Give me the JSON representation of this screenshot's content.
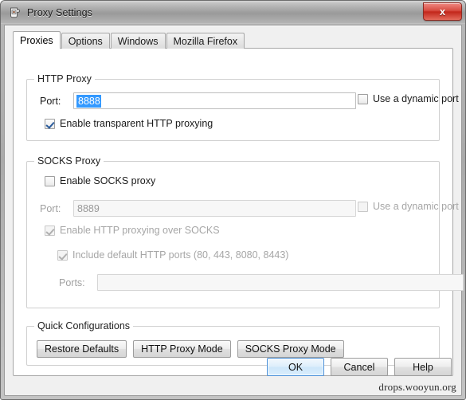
{
  "window": {
    "title": "Proxy Settings",
    "icon": "burp-jar-icon",
    "close_label": "x"
  },
  "tabs": [
    {
      "label": "Proxies",
      "active": true
    },
    {
      "label": "Options",
      "active": false
    },
    {
      "label": "Windows",
      "active": false
    },
    {
      "label": "Mozilla Firefox",
      "active": false
    }
  ],
  "http_proxy": {
    "group_title": "HTTP Proxy",
    "port_label": "Port:",
    "port_value": "8888",
    "port_selected": true,
    "dynamic_port_label": "Use a dynamic port",
    "dynamic_port_checked": false,
    "transparent_label": "Enable transparent HTTP proxying",
    "transparent_checked": true
  },
  "socks_proxy": {
    "group_title": "SOCKS Proxy",
    "enable_label": "Enable SOCKS proxy",
    "enable_checked": false,
    "port_label": "Port:",
    "port_value": "8889",
    "dynamic_port_label": "Use a dynamic port",
    "dynamic_port_checked": false,
    "http_over_socks_label": "Enable HTTP proxying over SOCKS",
    "http_over_socks_checked": true,
    "default_ports_label": "Include default HTTP ports (80, 443, 8080, 8443)",
    "default_ports_checked": true,
    "ports_label": "Ports:",
    "ports_value": ""
  },
  "quick_configurations": {
    "group_title": "Quick Configurations",
    "buttons": [
      {
        "label": "Restore Defaults"
      },
      {
        "label": "HTTP Proxy Mode"
      },
      {
        "label": "SOCKS Proxy Mode"
      }
    ]
  },
  "dialog_buttons": [
    {
      "label": "OK",
      "default": true
    },
    {
      "label": "Cancel",
      "default": false
    },
    {
      "label": "Help",
      "default": false
    }
  ],
  "watermark": "drops.wooyun.org",
  "colors": {
    "selection_blue": "#3399ff",
    "close_red": "#c2261b",
    "accent_border": "#4a90d9"
  }
}
